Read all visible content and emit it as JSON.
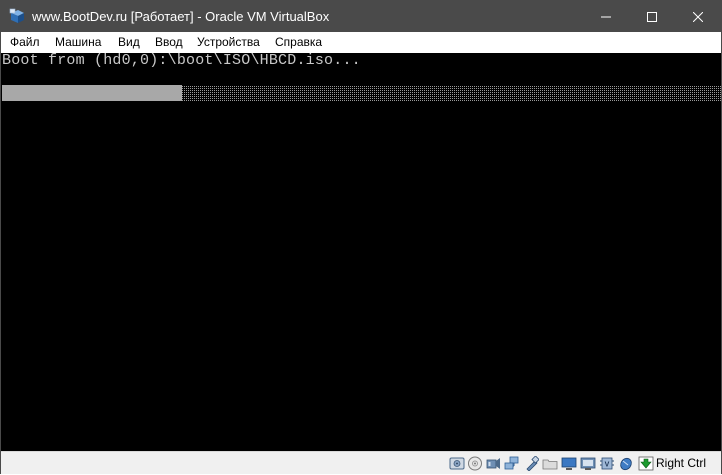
{
  "window": {
    "title": "www.BootDev.ru [Работает] - Oracle VM VirtualBox",
    "titlebar_color": "#4a4a4a"
  },
  "menu": {
    "items": [
      {
        "label": "Файл"
      },
      {
        "label": "Машина"
      },
      {
        "label": "Вид"
      },
      {
        "label": "Ввод"
      },
      {
        "label": "Устройства"
      },
      {
        "label": "Справка"
      }
    ]
  },
  "screen": {
    "boot_text": "Boot from (hd0,0):\\boot\\ISO\\HBCD.iso...",
    "progress_fraction": 0.25,
    "background": "#000000"
  },
  "statusbar": {
    "icons": [
      "hard-disk-icon",
      "optical-drive-icon",
      "audio-icon",
      "network-icon",
      "usb-icon",
      "shared-folders-icon",
      "display-icon",
      "video-capture-icon",
      "cpu-icon",
      "mouse-integration-icon",
      "host-key-arrow-icon"
    ],
    "host_key": "Right Ctrl"
  }
}
